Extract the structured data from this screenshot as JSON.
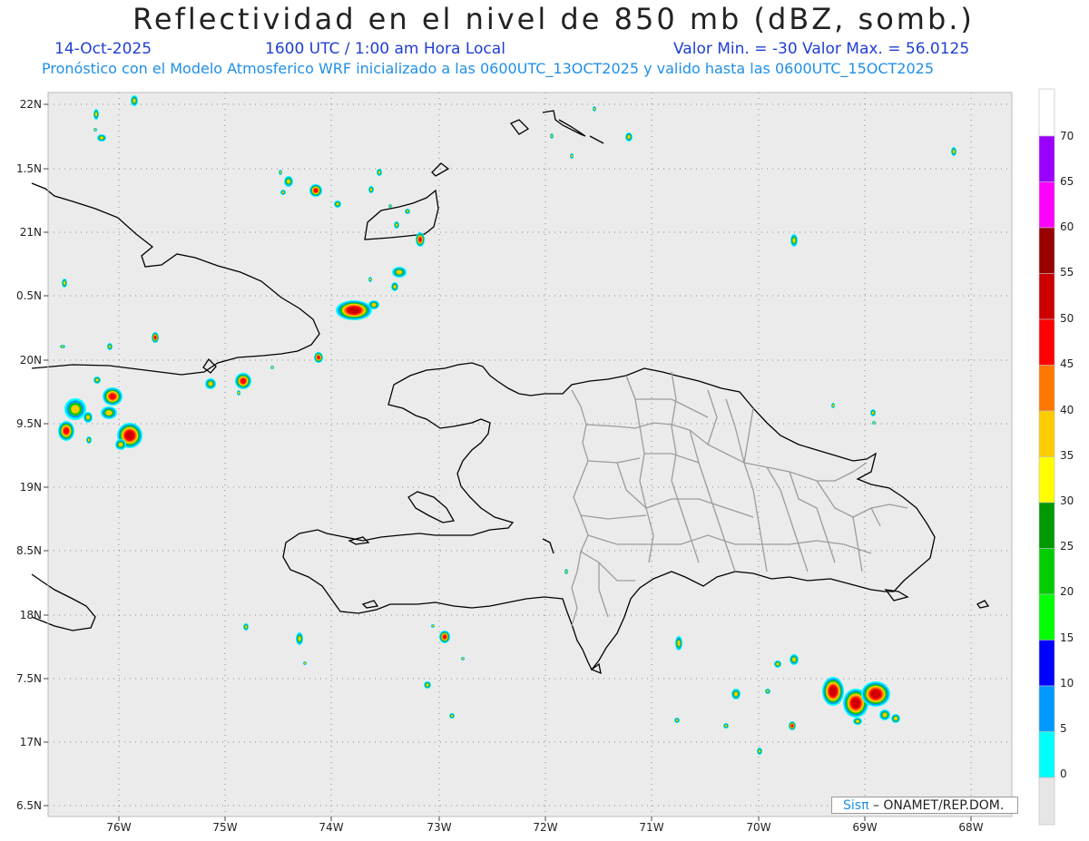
{
  "title": "Reflectividad en el nivel de 850 mb (dBZ, somb.)",
  "subtitle": {
    "date": "14-Oct-2025",
    "utc": "1600 UTC / 1:00 am Hora Local",
    "minmax": "Valor Min. = -30  Valor Max. = 56.0125",
    "model": "Pronóstico con el Modelo Atmosferico WRF inicializado a las 0600UTC_13OCT2025 y valido hasta las  0600UTC_15OCT2025"
  },
  "axes": {
    "lon_ticks": [
      "76W",
      "75W",
      "74W",
      "73W",
      "72W",
      "71W",
      "70W",
      "69W",
      "68W"
    ],
    "lat_ticks": [
      "22N",
      "1.5N",
      "21N",
      "0.5N",
      "20N",
      "9.5N",
      "19N",
      "8.5N",
      "18N",
      "7.5N",
      "17N",
      "6.5N"
    ]
  },
  "colorbar": {
    "labels": [
      "70",
      "65",
      "60",
      "55",
      "50",
      "45",
      "40",
      "35",
      "30",
      "25",
      "20",
      "15",
      "10",
      "5",
      "0"
    ],
    "colors": [
      "#ffffff",
      "#9900ff",
      "#ff00ff",
      "#990000",
      "#cc0000",
      "#ff0000",
      "#ff7700",
      "#ffcc00",
      "#ffff00",
      "#009900",
      "#00cc00",
      "#00ff00",
      "#0000ff",
      "#0099ff",
      "#00ffff",
      "#e6e6e6"
    ]
  },
  "credit": {
    "sis": "Sisπ",
    "org": "– ONAMET/REP.DOM."
  },
  "colors": {
    "map_bg": "#ebebeb",
    "coast": "#000000",
    "borders": "#999999",
    "subtitle_blue": "#1f3fd1",
    "subtitle_cyan": "#1f8fe6"
  }
}
